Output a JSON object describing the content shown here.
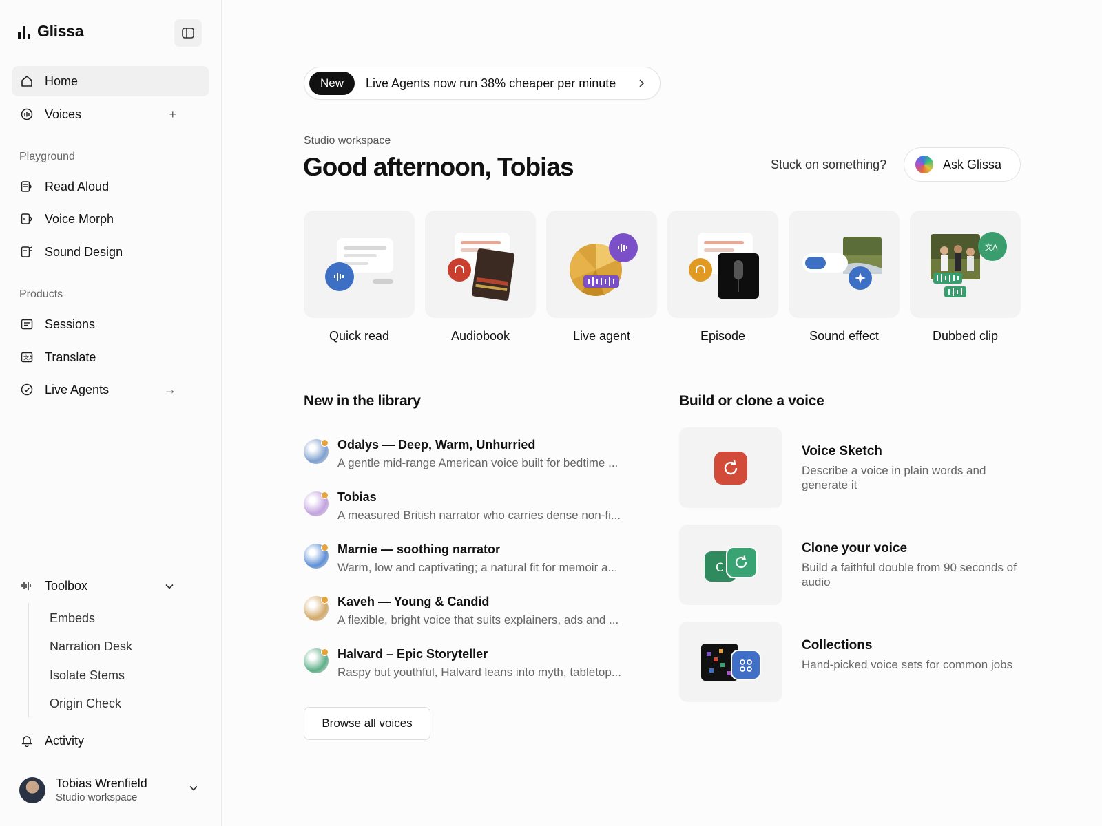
{
  "brand": {
    "name": "Glissa"
  },
  "sidebar": {
    "primary": [
      {
        "label": "Home",
        "icon": "home-icon",
        "active": true
      },
      {
        "label": "Voices",
        "icon": "voices-icon",
        "trailing": "+"
      }
    ],
    "playground_label": "Playground",
    "playground": [
      {
        "label": "Read Aloud",
        "icon": "read-aloud-icon"
      },
      {
        "label": "Voice Morph",
        "icon": "voice-morph-icon"
      },
      {
        "label": "Sound Design",
        "icon": "sound-design-icon"
      }
    ],
    "products_label": "Products",
    "products": [
      {
        "label": "Sessions",
        "icon": "sessions-icon"
      },
      {
        "label": "Translate",
        "icon": "translate-icon"
      },
      {
        "label": "Live Agents",
        "icon": "live-agents-icon",
        "trailing": "→"
      }
    ],
    "toolbox": {
      "label": "Toolbox",
      "items": [
        "Embeds",
        "Narration Desk",
        "Isolate Stems",
        "Origin Check"
      ]
    },
    "activity": "Activity",
    "user": {
      "name": "Tobias Wrenfield",
      "workspace": "Studio workspace"
    }
  },
  "announcement": {
    "badge": "New",
    "text": "Live Agents now run 38% cheaper per minute"
  },
  "header": {
    "eyebrow": "Studio workspace",
    "greeting": "Good afternoon, Tobias",
    "help_prompt": "Stuck on something?",
    "ask_button": "Ask Glissa"
  },
  "tiles": [
    {
      "label": "Quick read"
    },
    {
      "label": "Audiobook"
    },
    {
      "label": "Live agent"
    },
    {
      "label": "Episode"
    },
    {
      "label": "Sound effect"
    },
    {
      "label": "Dubbed clip"
    }
  ],
  "library": {
    "title": "New in the library",
    "voices": [
      {
        "name": "Odalys — Deep, Warm, Unhurried",
        "desc": "A gentle mid-range American voice built for bedtime ...",
        "color": "#7fa1cf"
      },
      {
        "name": "Tobias",
        "desc": "A measured British narrator who carries dense non-fi...",
        "color": "#c3a3e0"
      },
      {
        "name": "Marnie — soothing narrator",
        "desc": "Warm, low and captivating; a natural fit for memoir a...",
        "color": "#5f8fd6"
      },
      {
        "name": "Kaveh — Young & Candid",
        "desc": "A flexible, bright voice that suits explainers, ads and ...",
        "color": "#d3aa6b"
      },
      {
        "name": "Halvard – Epic Storyteller",
        "desc": "Raspy but youthful, Halvard leans into myth, tabletop...",
        "color": "#5fb08a"
      }
    ],
    "browse_button": "Browse all voices"
  },
  "build": {
    "title": "Build or clone a voice",
    "cards": [
      {
        "title": "Voice Sketch",
        "desc": "Describe a voice in plain words and generate it",
        "icon": "refresh-icon"
      },
      {
        "title": "Clone your voice",
        "desc": "Build a faithful double from 90 seconds of audio",
        "icon": "clone-icon"
      },
      {
        "title": "Collections",
        "desc": "Hand-picked voice sets for common jobs",
        "icon": "grid-icon"
      }
    ]
  },
  "colors": {
    "accent_dark": "#111111",
    "status_dot": "#e6a23c",
    "clone_green": "#3a9d6e",
    "sketch_red": "#d24a38",
    "collection_blue": "#3f6fc6"
  }
}
